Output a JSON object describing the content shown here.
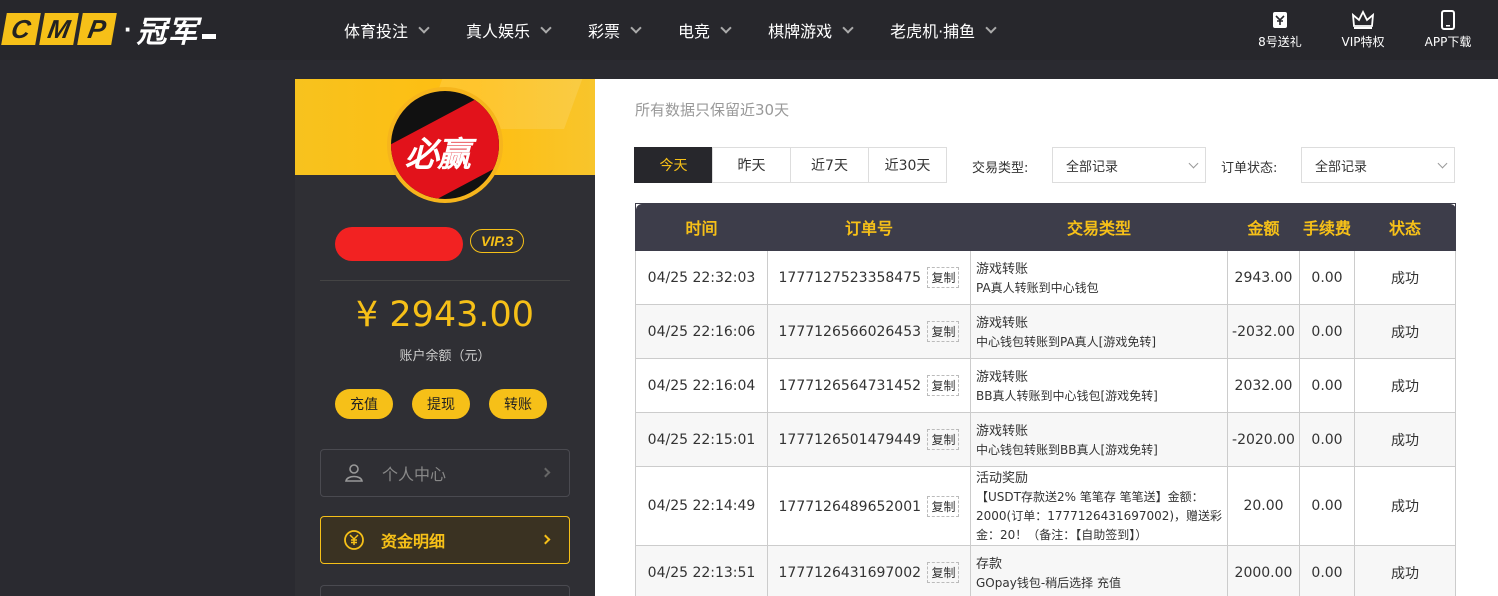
{
  "header": {
    "logo_letters": [
      "C",
      "M",
      "P"
    ],
    "logo_cn": "冠军",
    "nav": [
      {
        "label": "体育投注"
      },
      {
        "label": "真人娱乐"
      },
      {
        "label": "彩票"
      },
      {
        "label": "电竞"
      },
      {
        "label": "棋牌游戏"
      },
      {
        "label": "老虎机·捕鱼"
      }
    ],
    "quick_links": [
      {
        "label": "8号送礼",
        "icon": "ticket-icon"
      },
      {
        "label": "VIP特权",
        "icon": "crown-icon"
      },
      {
        "label": "APP下载",
        "icon": "phone-icon"
      }
    ]
  },
  "sidebar": {
    "avatar_text": "必赢",
    "vip_badge": "VIP.3",
    "balance": "¥ 2943.00",
    "balance_label": "账户余额（元）",
    "actions": [
      "充值",
      "提现",
      "转账"
    ],
    "menu": [
      {
        "label": "个人中心",
        "icon": "user-icon"
      },
      {
        "label": "资金明细",
        "icon": "coin-icon",
        "active": true
      }
    ]
  },
  "main": {
    "subtitle": "所有数据只保留近30天",
    "tabs": [
      {
        "label": "今天",
        "active": true
      },
      {
        "label": "昨天"
      },
      {
        "label": "近7天"
      },
      {
        "label": "近30天"
      }
    ],
    "filters": {
      "type_label": "交易类型:",
      "type_value": "全部记录",
      "status_label": "订单状态:",
      "status_value": "全部记录"
    },
    "table": {
      "headers": [
        "时间",
        "订单号",
        "交易类型",
        "金额",
        "手续费",
        "状态"
      ],
      "copy_label": "复制",
      "rows": [
        {
          "time": "04/25 22:32:03",
          "order": "1777127523358475",
          "type": "游戏转账",
          "detail": "PA真人转账到中心钱包",
          "amount": "2943.00",
          "fee": "0.00",
          "status": "成功"
        },
        {
          "time": "04/25 22:16:06",
          "order": "1777126566026453",
          "type": "游戏转账",
          "detail": "中心钱包转账到PA真人[游戏免转]",
          "amount": "-2032.00",
          "fee": "0.00",
          "status": "成功"
        },
        {
          "time": "04/25 22:16:04",
          "order": "1777126564731452",
          "type": "游戏转账",
          "detail": "BB真人转账到中心钱包[游戏免转]",
          "amount": "2032.00",
          "fee": "0.00",
          "status": "成功"
        },
        {
          "time": "04/25 22:15:01",
          "order": "1777126501479449",
          "type": "游戏转账",
          "detail": "中心钱包转账到BB真人[游戏免转]",
          "amount": "-2020.00",
          "fee": "0.00",
          "status": "成功"
        },
        {
          "time": "04/25 22:14:49",
          "order": "1777126489652001",
          "type": "活动奖励",
          "detail": "【USDT存款送2% 笔笔存 笔笔送】金额：2000(订单：1777126431697002)，赠送彩金：20！（备注：【自助签到】）",
          "amount": "20.00",
          "fee": "0.00",
          "status": "成功"
        },
        {
          "time": "04/25 22:13:51",
          "order": "1777126431697002",
          "type": "存款",
          "detail": "GOpay钱包-稍后选择 充值",
          "amount": "2000.00",
          "fee": "0.00",
          "status": "成功"
        }
      ]
    }
  },
  "colors": {
    "accent": "#f6c018",
    "header_bg": "#27272c",
    "sidebar_bg": "#2f2f34",
    "table_head_bg": "#3d3d4a",
    "success": "#33a033"
  }
}
